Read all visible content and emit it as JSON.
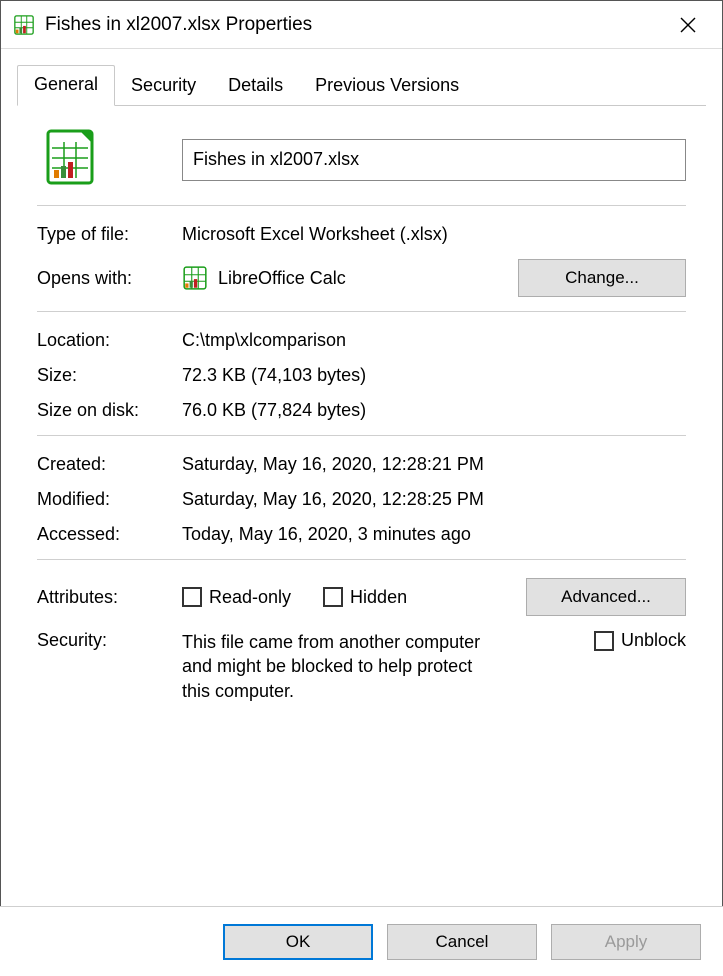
{
  "window": {
    "title": "Fishes in xl2007.xlsx Properties"
  },
  "tabs": {
    "general": "General",
    "security": "Security",
    "details": "Details",
    "previous": "Previous Versions"
  },
  "general": {
    "filename": "Fishes in xl2007.xlsx",
    "type_label": "Type of file:",
    "type_value": "Microsoft Excel Worksheet (.xlsx)",
    "opens_label": "Opens with:",
    "opens_value": "LibreOffice Calc",
    "change_btn": "Change...",
    "location_label": "Location:",
    "location_value": "C:\\tmp\\xlcomparison",
    "size_label": "Size:",
    "size_value": "72.3 KB (74,103 bytes)",
    "diskSize_label": "Size on disk:",
    "diskSize_value": "76.0 KB (77,824 bytes)",
    "created_label": "Created:",
    "created_value": "Saturday, May 16, 2020, 12:28:21 PM",
    "modified_label": "Modified:",
    "modified_value": "Saturday, May 16, 2020, 12:28:25 PM",
    "accessed_label": "Accessed:",
    "accessed_value": "Today, May 16, 2020, 3 minutes ago",
    "attributes_label": "Attributes:",
    "readonly_label": "Read-only",
    "hidden_label": "Hidden",
    "advanced_btn": "Advanced...",
    "security_label": "Security:",
    "security_text": "This file came from another computer and might be blocked to help protect this computer.",
    "unblock_label": "Unblock"
  },
  "footer": {
    "ok": "OK",
    "cancel": "Cancel",
    "apply": "Apply"
  }
}
